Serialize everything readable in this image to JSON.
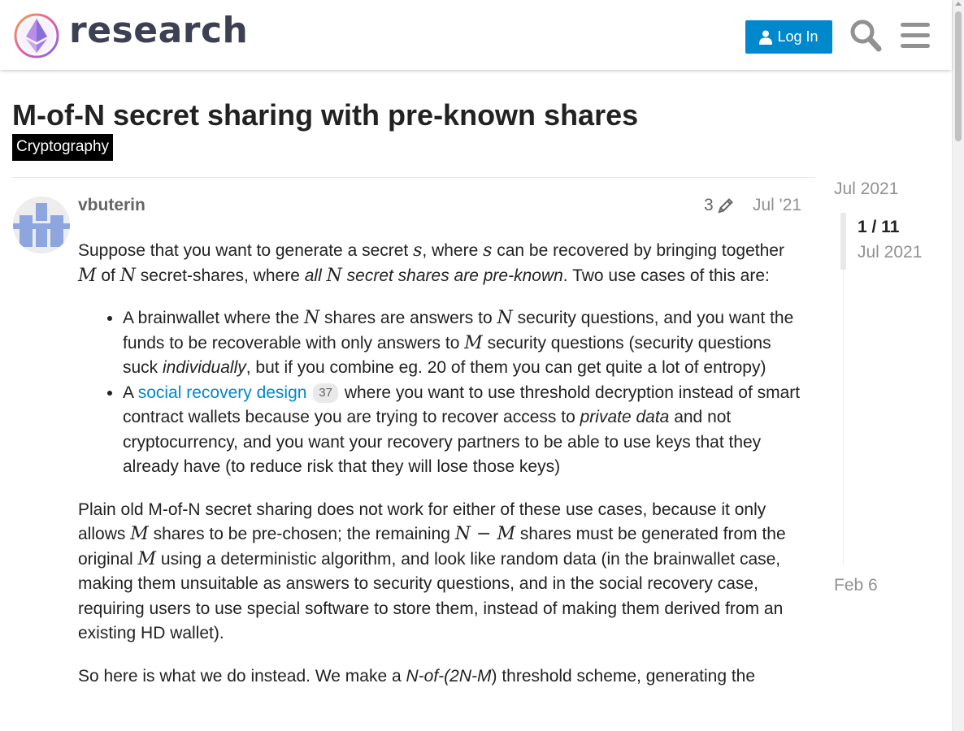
{
  "header": {
    "logo_text": "research",
    "login_label": "Log In",
    "icons": [
      "logo-icon",
      "user-icon",
      "search-icon",
      "hamburger-menu-icon"
    ]
  },
  "topic": {
    "title": "M-of-N secret sharing with pre-known shares",
    "category": "Cryptography"
  },
  "post": {
    "username": "vbuterin",
    "edit_count": "3",
    "date": "Jul '21",
    "p1": {
      "t1": "Suppose that you want to generate a secret ",
      "m1": "s",
      "t2": ", where ",
      "m2": "s",
      "t3": " can be recovered by bringing together ",
      "m3": "M",
      "t4": " of ",
      "m4": "N",
      "t5": " secret-shares, where ",
      "em1": "all ",
      "m5": "N",
      "em2": " secret shares are pre-known",
      "t6": ". Two use cases of this are:"
    },
    "li1": {
      "t1": "A brainwallet where the ",
      "m1": "N",
      "t2": " shares are answers to ",
      "m2": "N",
      "t3": " security questions, and you want the funds to be recoverable with only answers to ",
      "m3": "M",
      "t4": " security questions (security questions suck ",
      "em1": "individually",
      "t5": ", but if you combine eg. 20 of them you can get quite a lot of entropy)"
    },
    "li2": {
      "t1": "A ",
      "link": "social recovery design",
      "link_clicks": "37",
      "t2": " where you want to use threshold decryption instead of smart contract wallets because you are trying to recover access to ",
      "em1": "private data",
      "t3": " and not cryptocurrency, and you want your recovery partners to be able to use keys that they already have (to reduce risk that they will lose those keys)"
    },
    "p2": {
      "t1": "Plain old M-of-N secret sharing does not work for either of these use cases, because it only allows ",
      "m1": "M",
      "t2": " shares to be pre-chosen; the remaining ",
      "m2": "N − M",
      "t3": " shares must be generated from the original ",
      "m3": "M",
      "t4": " using a deterministic algorithm, and look like random data (in the brainwallet case, making them unsuitable as answers to security questions, and in the social recovery case, requiring users to use special software to store them, instead of making them derived from an existing HD wallet)."
    },
    "p3": {
      "t1": "So here is what we do instead. We make a ",
      "em1": "N-of-(2N-M",
      "t2": ") threshold scheme, generating the"
    }
  },
  "timeline": {
    "top_date": "Jul 2021",
    "position": "1 / 11",
    "position_date": "Jul 2021",
    "bottom_date": "Feb 6"
  },
  "colors": {
    "accent": "#0088cc",
    "muted": "#919191",
    "category_bg": "#000000",
    "avatar": "#8ea6e0"
  }
}
